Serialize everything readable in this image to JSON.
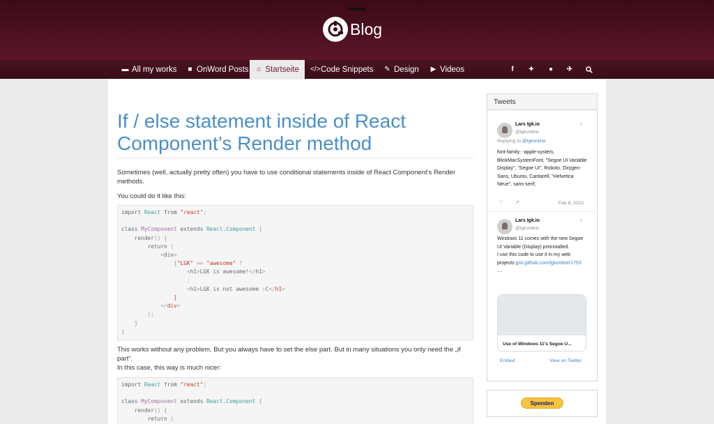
{
  "header": {
    "logo_text": "Blog"
  },
  "nav": {
    "items": [
      {
        "label": "All my works",
        "icon": "archive-icon"
      },
      {
        "label": "OnWord Posts",
        "icon": "document-icon"
      },
      {
        "label": "Startseite",
        "icon": "home-icon",
        "active": true
      },
      {
        "label": "Code Snippets",
        "icon": "code-icon"
      },
      {
        "label": "Design",
        "icon": "brush-icon"
      },
      {
        "label": "Videos",
        "icon": "play-icon"
      }
    ],
    "social": [
      "facebook-icon",
      "twitter-icon",
      "github-icon",
      "pin-icon",
      "search-icon"
    ]
  },
  "post": {
    "title": "If / else statement inside of React Component’s Render method",
    "intro": "Sometimes (well, actually pretty often) you have to use conditional statements inside of React Component’s Render methods.",
    "p2": "You could do it like this:",
    "p3a": "This works without any problem. But you always have to set the else part. But in many situations you only need the „if part“.",
    "p3b": "In this case, this way is much nicer:"
  },
  "sidebar": {
    "tweets_title": "Tweets",
    "tweet1": {
      "name": "Lars Igk.io",
      "handle": "@lgkonline",
      "reply_prefix": "Replying to",
      "reply_to": "@lgkonline",
      "text": "font-family: -apple-system, BlinkMacSystemFont, \"Segoe UI Variable Display\", \"Segoe UI\", Roboto, Oxygen-Sans, Ubuntu, Cantarell, \"Helvetica Neue\", sans-serif;",
      "date": "Feb 8, 2022"
    },
    "tweet2": {
      "name": "Lars Igk.io",
      "handle": "@lgkonline",
      "text": "Windows 11 comes with the new Segoe UI Variable (Display) preinstalled.\nI use this code to use it in my web projects:",
      "link": "gist.github.com/lgkonline/1753",
      "ellipsis": "…",
      "card_title": "Use of Windows 11's Segoe U..."
    },
    "embed_label": "Embed",
    "view_label": "View on Twitter",
    "donate_label": "Spenden"
  }
}
